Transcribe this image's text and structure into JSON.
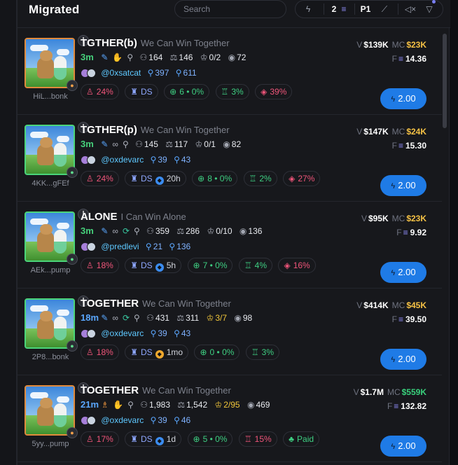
{
  "header": {
    "title": "Migrated",
    "search_placeholder": "Search",
    "quick_buy_amount": "2",
    "preset": "P1"
  },
  "colors": {
    "accent_blue": "#1f7be6",
    "age_green": "#46d07b",
    "mc_gold": "#f6c245",
    "mc_green": "#39d17c",
    "sol_purple": "#8f8cf7",
    "negative_red": "#f0557a"
  },
  "tokens": [
    {
      "ticker": "TGTHER(b)",
      "tagline": "We Can Win Together",
      "address": "HiL...bonk",
      "age": "3m",
      "age_color": "green",
      "holders": "164",
      "pro_traders": "146",
      "crowns": "0/2",
      "views": "72",
      "handle": "@0xsatcat",
      "followers": "397",
      "following": "611",
      "top10": "24%",
      "dev": "DS",
      "dev_extra": "",
      "snipers": "6 • 0%",
      "insiders": "3%",
      "bundles": "39%",
      "paid": "",
      "volume": "$139K",
      "mcap": "$23K",
      "mcap_color": "gold",
      "fees": "14.36",
      "buy_label": "2.00",
      "border": "orange",
      "icons": [
        "leaf-icon",
        "hand-icon",
        "search-icon"
      ]
    },
    {
      "ticker": "TGTHER(p)",
      "tagline": "We Can Win Together",
      "address": "4KK...gFEf",
      "age": "3m",
      "age_color": "green",
      "holders": "145",
      "pro_traders": "117",
      "crowns": "0/1",
      "views": "82",
      "handle": "@oxdevarc",
      "followers": "39",
      "following": "43",
      "top10": "24%",
      "dev": "DS",
      "dev_extra": "20h",
      "snipers": "8 • 0%",
      "insiders": "2%",
      "bundles": "27%",
      "paid": "",
      "volume": "$147K",
      "mcap": "$24K",
      "mcap_color": "gold",
      "fees": "15.30",
      "buy_label": "2.00",
      "border": "green",
      "icons": [
        "leaf-icon",
        "link-icon",
        "search-icon"
      ]
    },
    {
      "ticker": "ALONE",
      "tagline": "I Can Win Alone",
      "address": "AEk...pump",
      "age": "3m",
      "age_color": "green",
      "holders": "359",
      "pro_traders": "286",
      "crowns": "0/10",
      "views": "136",
      "handle": "@predlevi",
      "followers": "21",
      "following": "136",
      "top10": "18%",
      "dev": "DS",
      "dev_extra": "5h",
      "snipers": "7 • 0%",
      "insiders": "4%",
      "bundles": "16%",
      "paid": "",
      "volume": "$95K",
      "mcap": "$23K",
      "mcap_color": "gold",
      "fees": "9.92",
      "buy_label": "2.00",
      "border": "green",
      "icons": [
        "leaf-icon",
        "link-icon",
        "refresh-icon",
        "search-icon"
      ]
    },
    {
      "ticker": "TOGETHER",
      "tagline": "We Can Win Together",
      "address": "2P8...bonk",
      "age": "18m",
      "age_color": "blue",
      "holders": "431",
      "pro_traders": "311",
      "crowns": "3/7",
      "views": "98",
      "handle": "@oxdevarc",
      "followers": "39",
      "following": "43",
      "top10": "18%",
      "dev": "DS",
      "dev_extra": "1mo",
      "snipers": "0 • 0%",
      "insiders": "3%",
      "bundles": "",
      "paid": "",
      "volume": "$414K",
      "mcap": "$45K",
      "mcap_color": "gold",
      "fees": "39.50",
      "buy_label": "2.00",
      "border": "green",
      "icons": [
        "leaf-icon",
        "link-icon",
        "refresh-icon",
        "search-icon"
      ]
    },
    {
      "ticker": "TOGETHER",
      "tagline": "We Can Win Together",
      "address": "5yy...pump",
      "age": "21m",
      "age_color": "blue",
      "holders": "1,983",
      "pro_traders": "1,542",
      "crowns": "2/95",
      "views": "469",
      "handle": "@oxdevarc",
      "followers": "39",
      "following": "46",
      "top10": "17%",
      "dev": "DS",
      "dev_extra": "1d",
      "snipers": "5 • 0%",
      "insiders": "15%",
      "bundles": "",
      "paid": "Paid",
      "volume": "$1.7M",
      "mcap": "$559K",
      "mcap_color": "green",
      "fees": "132.82",
      "buy_label": "2.00",
      "border": "orange",
      "icons": [
        "people-icon",
        "hand-icon",
        "search-icon"
      ]
    }
  ]
}
